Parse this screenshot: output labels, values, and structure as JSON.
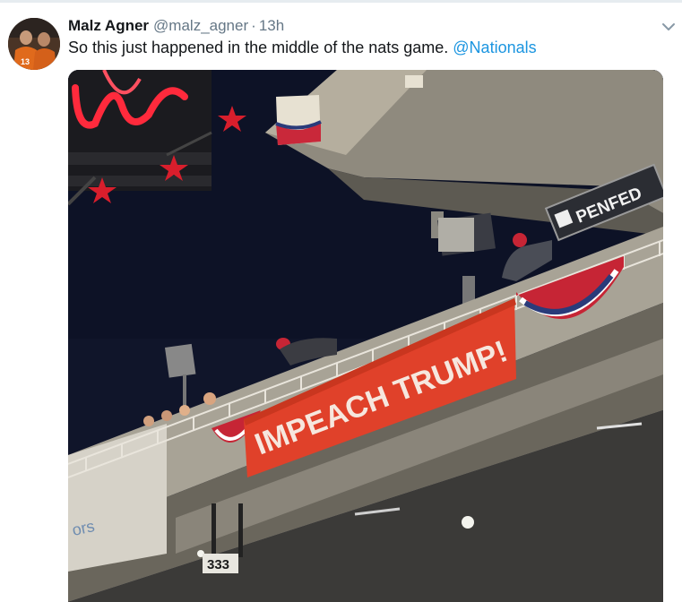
{
  "tweet": {
    "display_name": "Malz Agner",
    "handle": "@malz_agner",
    "separator": "·",
    "time": "13h",
    "text": "So this just happened in the middle of the nats game. ",
    "mention": "@Nationals",
    "menu_icon": "chevron-down-icon"
  },
  "media": {
    "banner_text": "IMPEACH TRUMP!",
    "sign_text": "PENFED",
    "section_number": "333",
    "colors": {
      "banner": "#e0412a",
      "night_sky": "#10152a",
      "concrete": "#b9b4a6",
      "neon": "#ff2a3c"
    }
  }
}
